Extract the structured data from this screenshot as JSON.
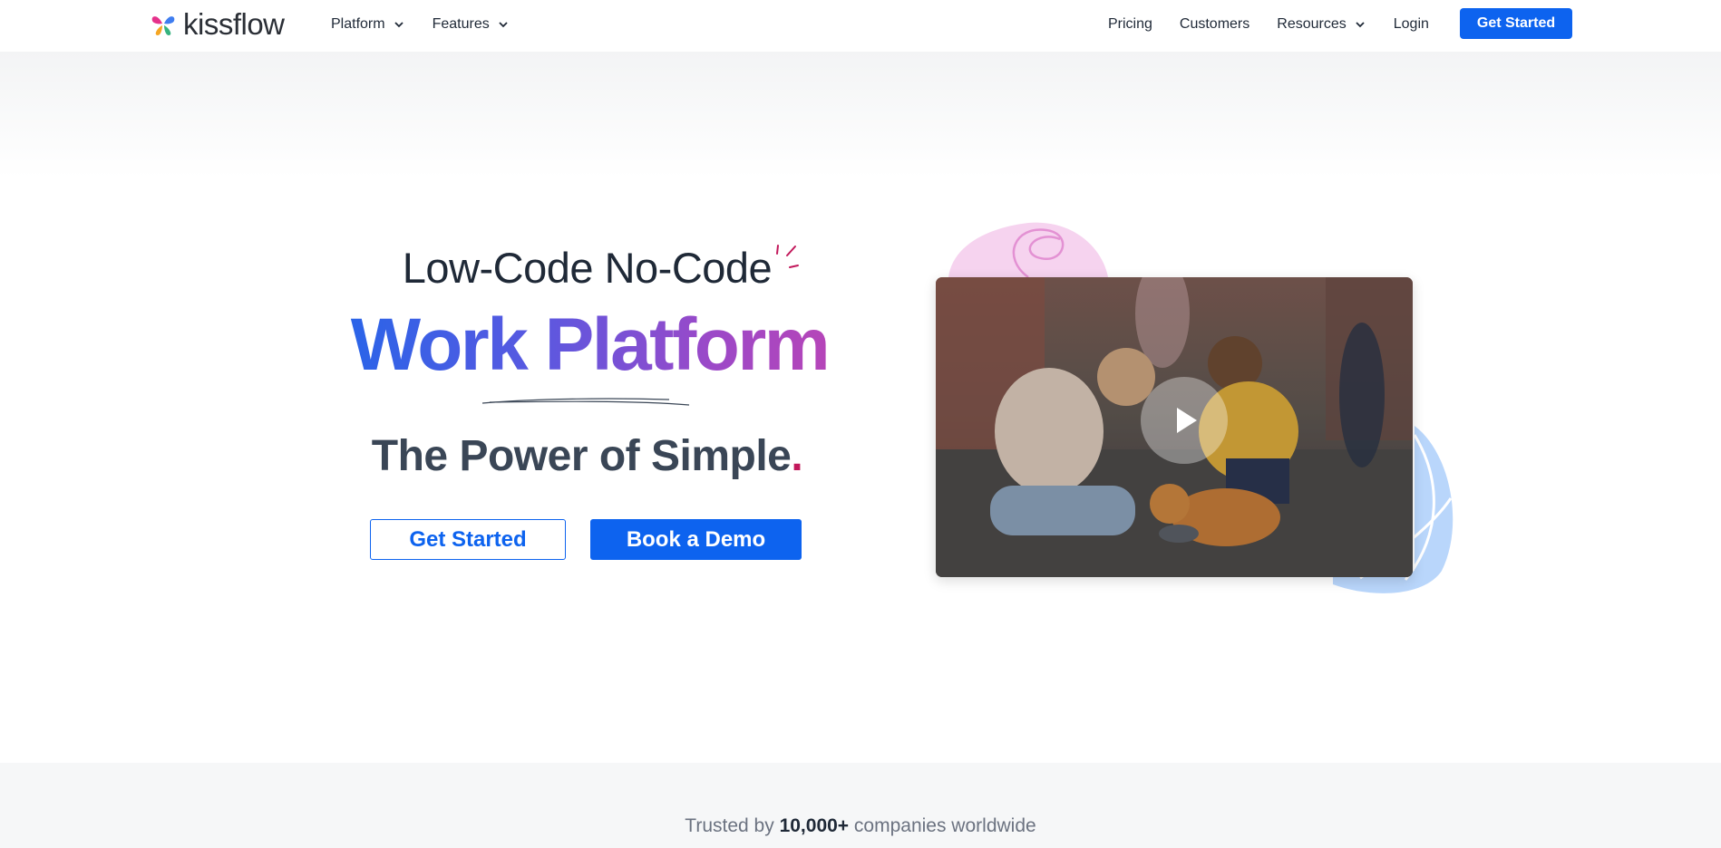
{
  "brand": {
    "name": "kissflow"
  },
  "nav": {
    "left_items": [
      {
        "label": "Platform",
        "has_dropdown": true
      },
      {
        "label": "Features",
        "has_dropdown": true
      }
    ],
    "right_items": [
      {
        "label": "Pricing",
        "has_dropdown": false
      },
      {
        "label": "Customers",
        "has_dropdown": false
      },
      {
        "label": "Resources",
        "has_dropdown": true
      },
      {
        "label": "Login",
        "has_dropdown": false
      }
    ],
    "cta_label": "Get Started"
  },
  "hero": {
    "subheading": "Low-Code No-Code",
    "heading": "Work Platform",
    "tagline": "The Power of Simple",
    "tagline_dot": ".",
    "primary_button": "Book a Demo",
    "secondary_button": "Get Started"
  },
  "video": {
    "play_icon": "play-icon"
  },
  "trust": {
    "prefix": "Trusted by",
    "count": "10,000+",
    "suffix": "companies worldwide"
  },
  "colors": {
    "brand_blue": "#0d63ef",
    "gradient_start": "#2a64e8",
    "gradient_end": "#b645b8",
    "accent_magenta": "#c2185b"
  }
}
